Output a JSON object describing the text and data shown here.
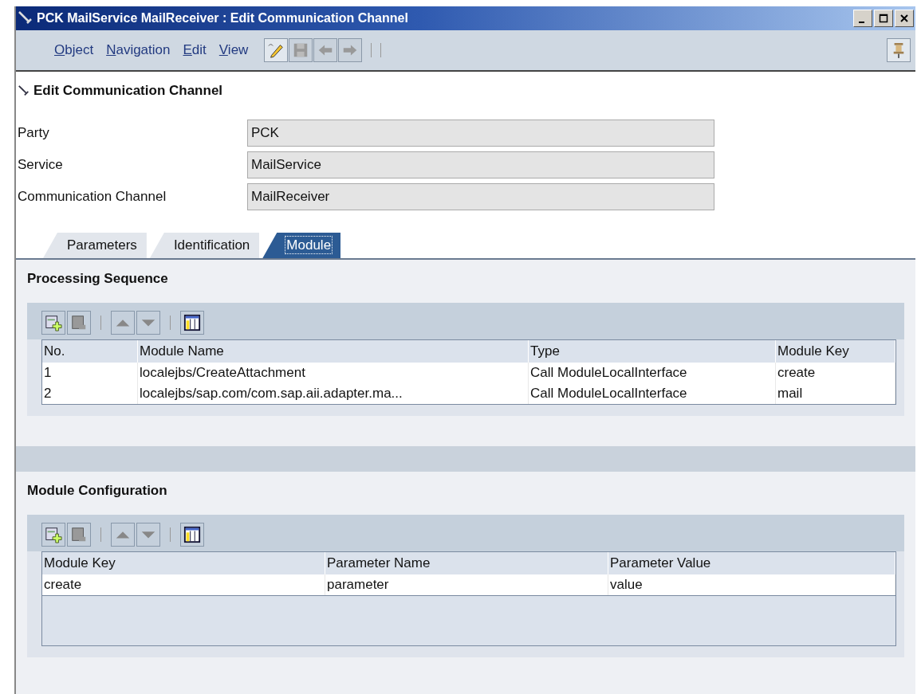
{
  "window": {
    "title": "PCK MailService MailReceiver : Edit Communication Channel"
  },
  "menu": [
    {
      "label": "Object"
    },
    {
      "label": "Navigation"
    },
    {
      "label": "Edit"
    },
    {
      "label": "View"
    }
  ],
  "toolbar": [
    {
      "kind": "edit",
      "disabled": false
    },
    {
      "kind": "save",
      "disabled": true
    },
    {
      "kind": "back",
      "disabled": true
    },
    {
      "kind": "forward",
      "disabled": true
    }
  ],
  "heading": "Edit Communication Channel",
  "fields": [
    {
      "label": "Party",
      "value": "PCK"
    },
    {
      "label": "Service",
      "value": "MailService"
    },
    {
      "label": "Communication Channel",
      "value": "MailReceiver"
    }
  ],
  "tabs": [
    {
      "label": "Parameters",
      "selected": false
    },
    {
      "label": "Identification",
      "selected": false
    },
    {
      "label": "Module",
      "selected": true
    }
  ],
  "sections": [
    {
      "title": "Processing Sequence",
      "tools": [
        {
          "kind": "add",
          "disabled": false
        },
        {
          "kind": "delete",
          "disabled": true
        },
        {
          "kind": "up",
          "disabled": true
        },
        {
          "kind": "down",
          "disabled": true
        },
        {
          "kind": "columns",
          "disabled": false
        }
      ],
      "columns": [
        "No.",
        "Module Name",
        "Type",
        "Module Key"
      ],
      "rows": [
        [
          "1",
          "localejbs/CreateAttachment",
          "Call ModuleLocalInterface",
          "create"
        ],
        [
          "2",
          "localejbs/sap.com/com.sap.aii.adapter.ma...",
          "Call ModuleLocalInterface",
          "mail"
        ]
      ]
    },
    {
      "title": "Module Configuration",
      "tools": [
        {
          "kind": "add",
          "disabled": false
        },
        {
          "kind": "delete",
          "disabled": true
        },
        {
          "kind": "up",
          "disabled": true
        },
        {
          "kind": "down",
          "disabled": true
        },
        {
          "kind": "columns",
          "disabled": false
        }
      ],
      "columns": [
        "Module Key",
        "Parameter Name",
        "Parameter Value"
      ],
      "rows": [
        [
          "create",
          "parameter",
          "value"
        ]
      ]
    }
  ]
}
